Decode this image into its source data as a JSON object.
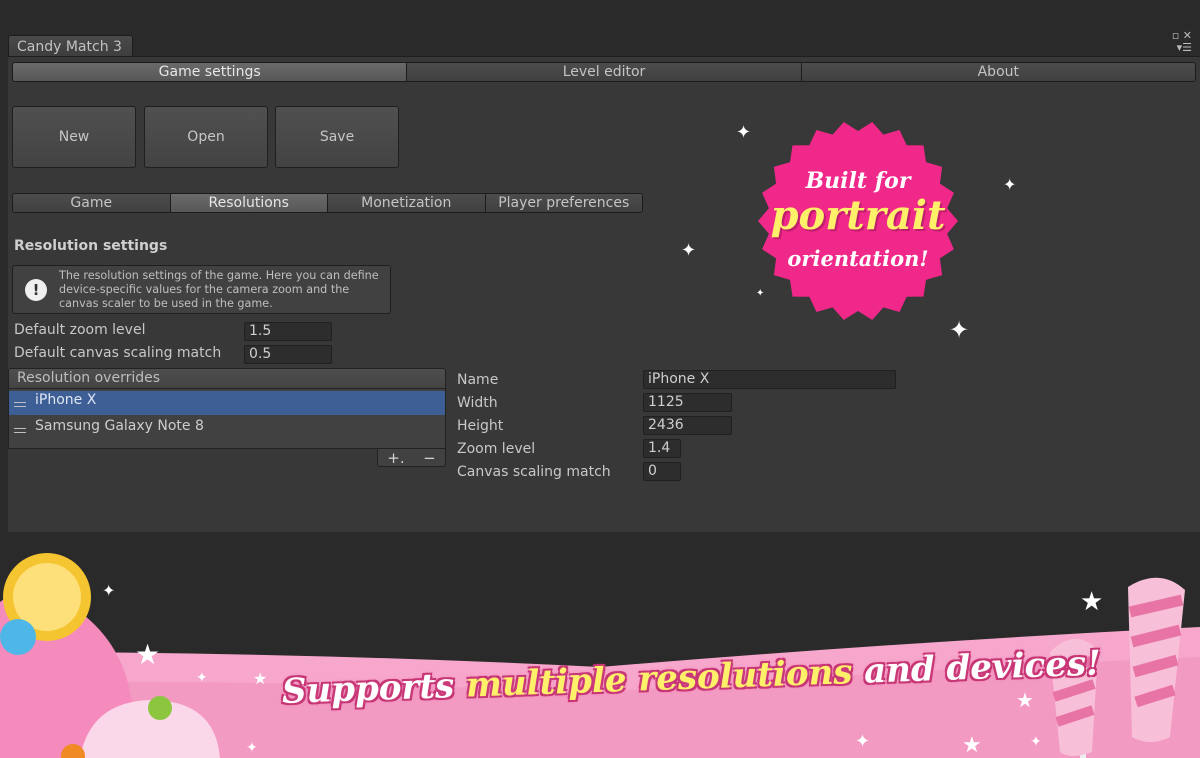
{
  "window": {
    "tab_title": "Candy Match 3",
    "controls": [
      "▫ ✕",
      "▾☰"
    ]
  },
  "main_tabs": [
    {
      "label": "Game settings",
      "active": true
    },
    {
      "label": "Level editor",
      "active": false
    },
    {
      "label": "About",
      "active": false
    }
  ],
  "toolbar": {
    "new_label": "New",
    "open_label": "Open",
    "save_label": "Save"
  },
  "sub_tabs": [
    {
      "label": "Game",
      "active": false
    },
    {
      "label": "Resolutions",
      "active": true
    },
    {
      "label": "Monetization",
      "active": false
    },
    {
      "label": "Player preferences",
      "active": false
    }
  ],
  "resolution_settings": {
    "title": "Resolution settings",
    "help_text": "The resolution settings of the game. Here you can define device-specific values for the camera zoom and the canvas scaler to be used in the game.",
    "default_zoom_label": "Default zoom level",
    "default_zoom_value": "1.5",
    "default_canvas_label": "Default canvas scaling match",
    "default_canvas_value": "0.5"
  },
  "overrides": {
    "header": "Resolution overrides",
    "items": [
      {
        "label": "iPhone X",
        "selected": true
      },
      {
        "label": "Samsung Galaxy Note 8",
        "selected": false
      }
    ],
    "add_label": "+.",
    "remove_label": "−"
  },
  "detail": {
    "name_label": "Name",
    "name_value": "iPhone X",
    "width_label": "Width",
    "width_value": "1125",
    "height_label": "Height",
    "height_value": "2436",
    "zoom_label": "Zoom level",
    "zoom_value": "1.4",
    "canvas_label": "Canvas scaling match",
    "canvas_value": "0"
  },
  "promo": {
    "badge_line1": "Built for",
    "badge_line2": "portrait",
    "badge_line3": "orientation!",
    "banner_part1": "Supports",
    "banner_part2": "multiple resolutions",
    "banner_part3": "and devices!"
  },
  "colors": {
    "selection": "#3e5f96",
    "badge_pink": "#f0288a",
    "banner_pink": "#f7a6cc",
    "highlight_yellow": "#fff06a"
  }
}
